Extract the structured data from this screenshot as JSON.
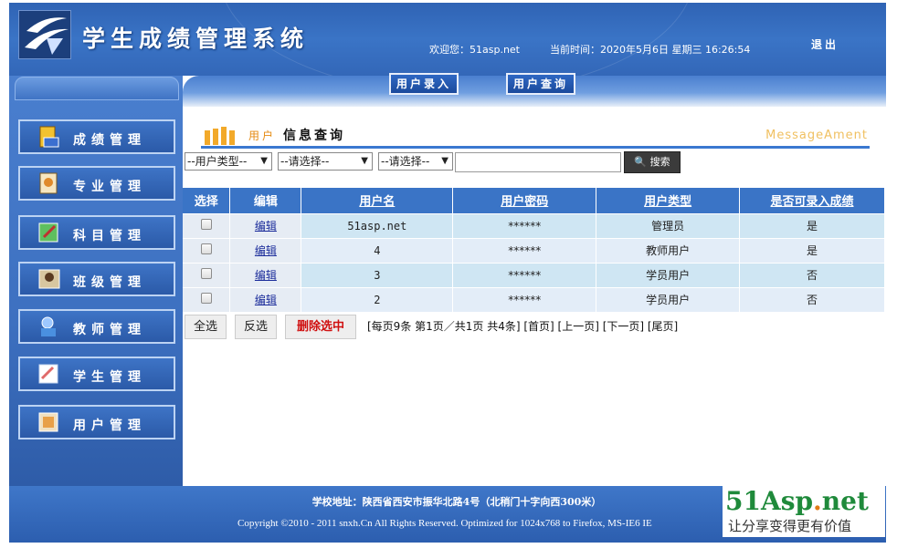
{
  "header": {
    "title": "学生成绩管理系统",
    "welcome": "欢迎您：51asp.net",
    "current_time": "当前时间：2020年5月6日 星期三 16:26:54",
    "logout": "退出"
  },
  "top_nav": {
    "user_entry": "用户录入",
    "user_query": "用户查询"
  },
  "sidebar": {
    "items": [
      {
        "label": "成绩管理",
        "icon": "grades-icon"
      },
      {
        "label": "专业管理",
        "icon": "major-icon"
      },
      {
        "label": "科目管理",
        "icon": "subject-icon"
      },
      {
        "label": "班级管理",
        "icon": "class-icon"
      },
      {
        "label": "教师管理",
        "icon": "teacher-icon"
      },
      {
        "label": "学生管理",
        "icon": "student-icon"
      },
      {
        "label": "用户管理",
        "icon": "user-icon"
      }
    ]
  },
  "section": {
    "title_prefix": "用户",
    "title": "信息查询",
    "title_en": "MessageAment"
  },
  "search": {
    "user_type_select": "--用户类型--",
    "select_2": "--请选择--",
    "select_3": "--请选择--",
    "input_value": "",
    "button_label": "搜索"
  },
  "table": {
    "headers": [
      "选择",
      "编辑",
      "用户名",
      "用户密码",
      "用户类型",
      "是否可录入成绩"
    ],
    "rows": [
      {
        "edit": "编辑",
        "username": "51asp.net",
        "password": "******",
        "type": "管理员",
        "can_enter": "是"
      },
      {
        "edit": "编辑",
        "username": "4",
        "password": "******",
        "type": "教师用户",
        "can_enter": "是"
      },
      {
        "edit": "编辑",
        "username": "3",
        "password": "******",
        "type": "学员用户",
        "can_enter": "否"
      },
      {
        "edit": "编辑",
        "username": "2",
        "password": "******",
        "type": "学员用户",
        "can_enter": "否"
      }
    ]
  },
  "actions": {
    "select_all": "全选",
    "invert": "反选",
    "delete_selected": "删除选中"
  },
  "pager": {
    "text": "[每页9条 第1页／共1页 共4条] [首页] [上一页] [下一页] [尾页]"
  },
  "footer": {
    "address": "学校地址：陕西省西安市振华北路4号（北稍门十字向西300米）",
    "copyright": "Copyright ©2010 - 2011 snxh.Cn All Rights Reserved. Optimized for 1024x768 to Firefox, MS-IE6 IE"
  },
  "watermark": {
    "brand_a": "51Asp",
    "brand_dot": ".",
    "brand_b": "net",
    "slogan": "让分享变得更有价值"
  },
  "colors": {
    "header_blue": "#3367b8",
    "table_header": "#3a74c6",
    "delete_red": "#d01010",
    "watermark_green": "#1f8a3b"
  }
}
